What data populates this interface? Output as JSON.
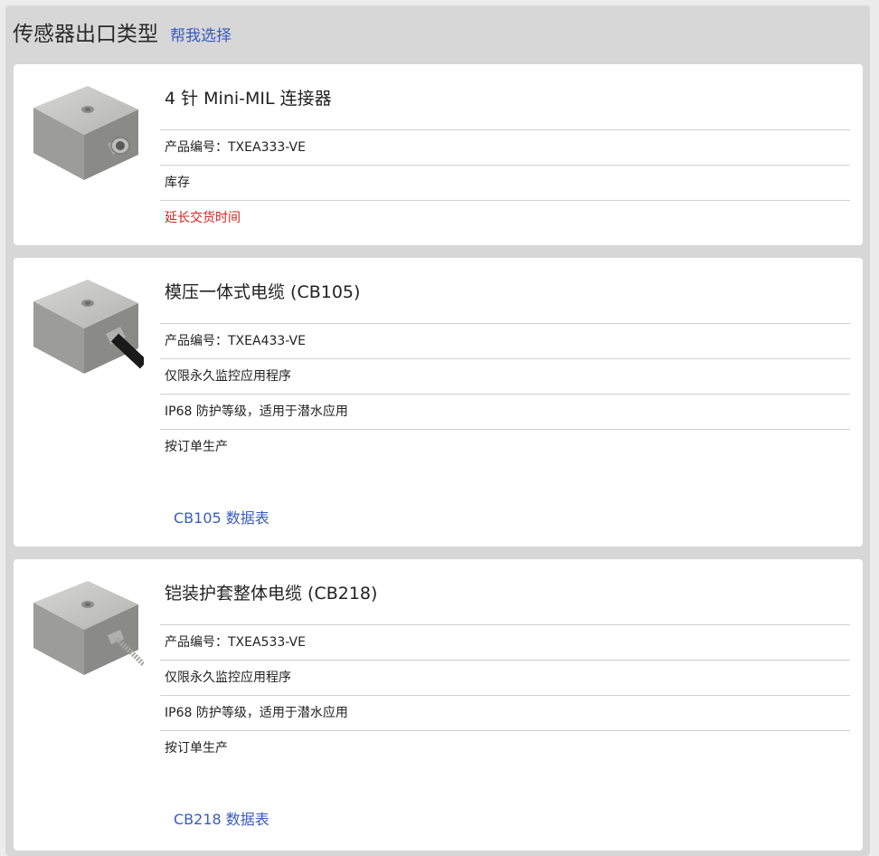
{
  "header": {
    "title": "传感器出口类型",
    "help_link": "帮我选择"
  },
  "products": [
    {
      "title": "4 针 Mini-MIL 连接器",
      "part_number": "产品编号：TXEA333-VE",
      "rows": [
        "库存"
      ],
      "notice": "延长交货时间",
      "image_icon": "sensor-connector-image"
    },
    {
      "title": "模压一体式电缆 (CB105)",
      "part_number": "产品编号：TXEA433-VE",
      "rows": [
        "仅限永久监控应用程序",
        "IP68 防护等级，适用于潜水应用",
        "按订单生产"
      ],
      "datasheet": "CB105 数据表",
      "image_icon": "sensor-molded-cable-image"
    },
    {
      "title": "铠装护套整体电缆 (CB218)",
      "part_number": "产品编号：TXEA533-VE",
      "rows": [
        "仅限永久监控应用程序",
        "IP68 防护等级，适用于潜水应用",
        "按订单生产"
      ],
      "datasheet": "CB218 数据表",
      "image_icon": "sensor-armored-cable-image"
    }
  ],
  "colors": {
    "link": "#3a5bbf",
    "notice": "#d22222",
    "panel_bg": "#d7d7d7",
    "card_bg": "#ffffff"
  }
}
